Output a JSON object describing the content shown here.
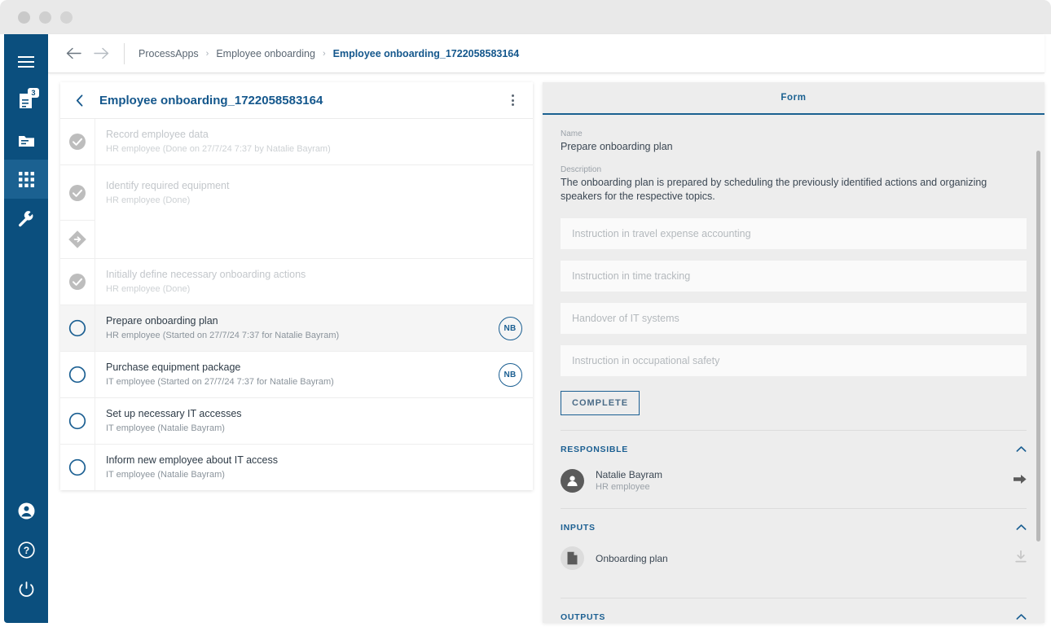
{
  "window": {
    "dots": [
      "close-dot",
      "minimize-dot",
      "maximize-dot"
    ]
  },
  "sidebar": {
    "top_items": [
      {
        "icon": "hamburger-menu-icon",
        "label": "Menu",
        "active": false,
        "badge": ""
      },
      {
        "icon": "tasks-icon",
        "label": "My tasks",
        "active": false,
        "badge": "3"
      },
      {
        "icon": "folder-icon",
        "label": "Archive",
        "active": false,
        "badge": ""
      },
      {
        "icon": "apps-grid-icon",
        "label": "Process apps",
        "active": true,
        "badge": ""
      },
      {
        "icon": "wrench-icon",
        "label": "Administration",
        "active": false,
        "badge": ""
      }
    ],
    "bottom_items": [
      {
        "icon": "account-icon",
        "label": "Account"
      },
      {
        "icon": "help-icon",
        "label": "Help"
      },
      {
        "icon": "power-icon",
        "label": "Logout"
      }
    ],
    "color": "#0b4f7e",
    "active_color": "#1b6191"
  },
  "topbar": {
    "back_icon": "arrow-left-icon",
    "forward_icon": "arrow-right-icon",
    "breadcrumb": [
      {
        "label": "ProcessApps",
        "current": false
      },
      {
        "label": "Employee onboarding",
        "current": false
      },
      {
        "label": "Employee onboarding_1722058583164",
        "current": true
      }
    ],
    "separator": "›"
  },
  "task_panel": {
    "back_icon": "chevron-left-icon",
    "title": "Employee onboarding_1722058583164",
    "menu_icon": "kebab-menu-icon",
    "rows": [
      {
        "state": "done",
        "icon": "check-circle-filled-icon",
        "name": "Record employee data",
        "sub": "HR employee (Done on 27/7/24 7:37 by Natalie Bayram)",
        "avatar": "",
        "selected": false
      },
      {
        "state": "done",
        "icon": "check-circle-filled-icon",
        "name": "Identify required equipment",
        "sub": "HR employee (Done)",
        "avatar": "",
        "selected": false
      },
      {
        "state": "gateway",
        "icon": "gateway-diamond-icon",
        "name": "",
        "sub": "",
        "avatar": "",
        "selected": false
      },
      {
        "state": "done",
        "icon": "check-circle-filled-icon",
        "name": "Initially define necessary onboarding actions",
        "sub": "HR employee (Done)",
        "avatar": "",
        "selected": false
      },
      {
        "state": "open",
        "icon": "circle-outline-icon",
        "name": "Prepare onboarding plan",
        "sub": "HR employee (Started on 27/7/24 7:37 for Natalie Bayram)",
        "avatar": "NB",
        "selected": true
      },
      {
        "state": "open",
        "icon": "circle-outline-icon",
        "name": "Purchase equipment package",
        "sub": "IT employee (Started on 27/7/24 7:37 for Natalie Bayram)",
        "avatar": "NB",
        "selected": false
      },
      {
        "state": "open",
        "icon": "circle-outline-icon",
        "name": "Set up necessary IT accesses",
        "sub": "IT employee (Natalie Bayram)",
        "avatar": "",
        "selected": false
      },
      {
        "state": "open",
        "icon": "circle-outline-icon",
        "name": "Inform new employee about IT access",
        "sub": "IT employee (Natalie Bayram)",
        "avatar": "",
        "selected": false
      }
    ]
  },
  "form_panel": {
    "tab_label": "Form",
    "name_label": "Name",
    "name_value": "Prepare onboarding plan",
    "description_label": "Description",
    "description_value": "The onboarding plan is prepared by scheduling the previously identified actions and organizing speakers for the respective topics.",
    "inputs": [
      {
        "placeholder": "Instruction in travel expense accounting",
        "value": ""
      },
      {
        "placeholder": "Instruction in time tracking",
        "value": ""
      },
      {
        "placeholder": "Handover of IT systems",
        "value": ""
      },
      {
        "placeholder": "Instruction in occupational safety",
        "value": ""
      }
    ],
    "complete_button": "COMPLETE",
    "sections": [
      {
        "title": "RESPONSIBLE",
        "chevron": "chevron-up-icon",
        "person_name": "Natalie Bayram",
        "person_role": "HR employee",
        "action_icon": "forward-arrow-icon"
      },
      {
        "title": "INPUTS",
        "chevron": "chevron-up-icon",
        "document_name": "Onboarding plan",
        "action_icon": "download-icon"
      },
      {
        "title": "OUTPUTS",
        "chevron": "chevron-up-icon"
      }
    ],
    "accent_color": "#1b6191"
  }
}
